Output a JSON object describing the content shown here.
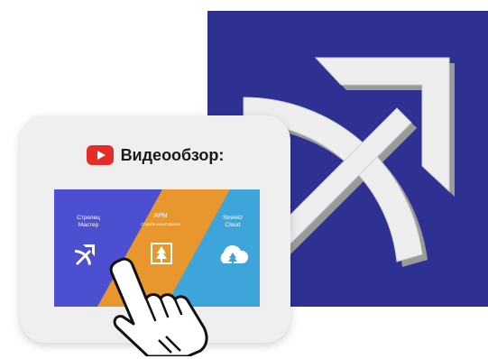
{
  "card": {
    "title": "Видеообзор:"
  },
  "thumbnail": {
    "panels": [
      {
        "label": "Стрелец\nМастер",
        "icon": "archer-icon"
      },
      {
        "label": "АРМ",
        "sublabel": "Служба мониторинга",
        "icon": "arm-monitor-icon"
      },
      {
        "label": "Streletz\nCloud",
        "icon": "cloud-tree-icon"
      }
    ]
  },
  "colors": {
    "brand_navy": "#2e3192",
    "panel_blue": "#4b4fd0",
    "panel_orange": "#e8962e",
    "panel_sky": "#3da5d9",
    "youtube_red": "#e52d27"
  },
  "icons": {
    "big_logo": "archer-bow-arrow-logo",
    "video_platform": "youtube-icon",
    "pointer": "hand-cursor-icon"
  }
}
